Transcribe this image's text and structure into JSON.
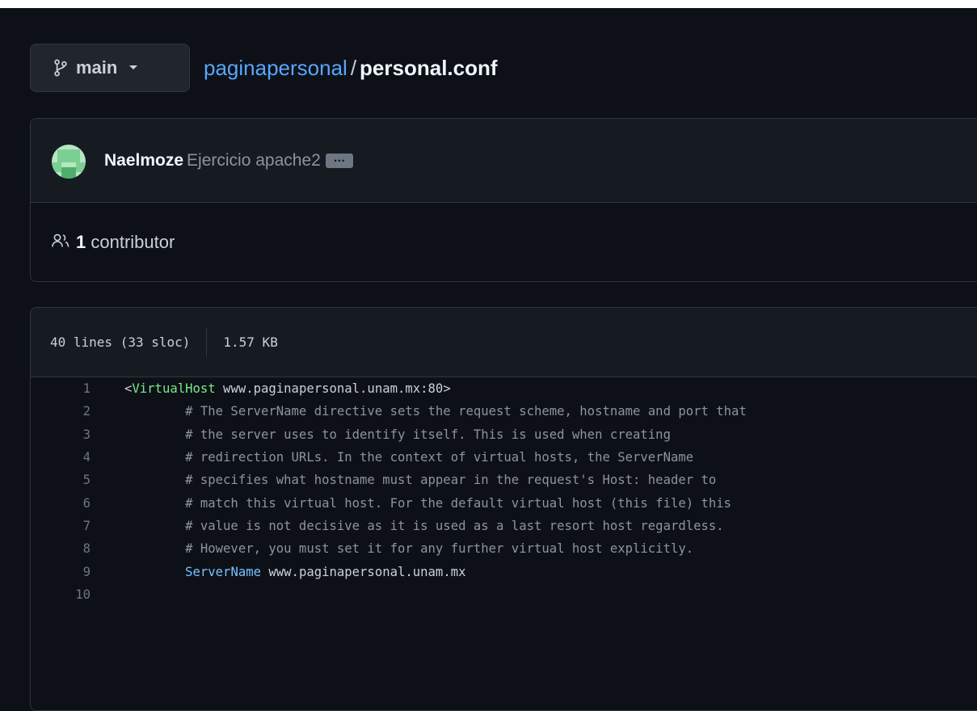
{
  "header": {
    "branch": "main",
    "repo": "paginapersonal",
    "separator": "/",
    "file": "personal.conf"
  },
  "commit": {
    "author": "Naelmoze",
    "message": "Ejercicio apache2",
    "ellipsis": "…"
  },
  "contributors": {
    "count": "1",
    "label": "contributor"
  },
  "file_info": {
    "lines": "40 lines (33 sloc)",
    "size": "1.57 KB"
  },
  "code": {
    "lines": [
      {
        "n": "1",
        "parts": [
          {
            "t": "<",
            "c": "src"
          },
          {
            "t": "VirtualHost",
            "c": "tag"
          },
          {
            "t": " www.paginapersonal.unam.mx:80>",
            "c": "src"
          }
        ]
      },
      {
        "n": "2",
        "parts": [
          {
            "t": "        # The ServerName directive sets the request scheme, hostname and port that",
            "c": "cm"
          }
        ]
      },
      {
        "n": "3",
        "parts": [
          {
            "t": "        # the server uses to identify itself. This is used when creating",
            "c": "cm"
          }
        ]
      },
      {
        "n": "4",
        "parts": [
          {
            "t": "        # redirection URLs. In the context of virtual hosts, the ServerName",
            "c": "cm"
          }
        ]
      },
      {
        "n": "5",
        "parts": [
          {
            "t": "        # specifies what hostname must appear in the request's Host: header to",
            "c": "cm"
          }
        ]
      },
      {
        "n": "6",
        "parts": [
          {
            "t": "        # match this virtual host. For the default virtual host (this file) this",
            "c": "cm"
          }
        ]
      },
      {
        "n": "7",
        "parts": [
          {
            "t": "        # value is not decisive as it is used as a last resort host regardless.",
            "c": "cm"
          }
        ]
      },
      {
        "n": "8",
        "parts": [
          {
            "t": "        # However, you must set it for any further virtual host explicitly.",
            "c": "cm"
          }
        ]
      },
      {
        "n": "9",
        "parts": [
          {
            "t": "        ",
            "c": "src"
          },
          {
            "t": "ServerName",
            "c": "kw"
          },
          {
            "t": " www.paginapersonal.unam.mx",
            "c": "src"
          }
        ]
      },
      {
        "n": "10",
        "parts": []
      }
    ]
  },
  "colors": {
    "background": "#0d1117",
    "link": "#58a6ff",
    "tag": "#7ee787",
    "keyword": "#79c0ff",
    "comment": "#8b949e"
  }
}
